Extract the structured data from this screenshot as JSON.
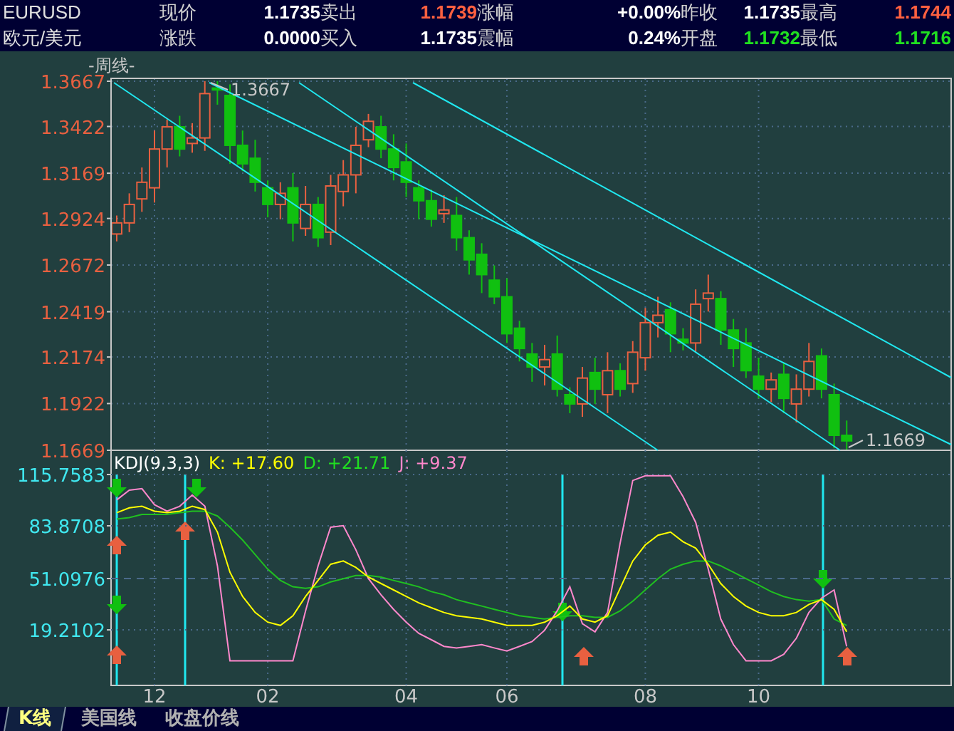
{
  "quote": {
    "symbol": "EURUSD",
    "name": "欧元/美元",
    "rows": [
      [
        {
          "label": "现价",
          "value": "1.1735",
          "color": "#ffffff"
        },
        {
          "label": "卖出",
          "value": "1.1739",
          "color": "#ff6040"
        },
        {
          "label": "涨幅",
          "value": "+0.00%",
          "color": "#ffffff"
        },
        {
          "label": "昨收",
          "value": "1.1735",
          "color": "#ffffff"
        },
        {
          "label": "最高",
          "value": "1.1744",
          "color": "#ff6040"
        }
      ],
      [
        {
          "label": "涨跌",
          "value": "0.0000",
          "color": "#ffffff"
        },
        {
          "label": "买入",
          "value": "1.1735",
          "color": "#ffffff"
        },
        {
          "label": "震幅",
          "value": "0.24%",
          "color": "#ffffff"
        },
        {
          "label": "开盘",
          "value": "1.1732",
          "color": "#20e020"
        },
        {
          "label": "最低",
          "value": "1.1716",
          "color": "#20e020"
        }
      ]
    ]
  },
  "chart": {
    "period_label": "-周线-",
    "high_label": "1.3667",
    "low_label": "1.1669",
    "chart_data": {
      "type": "candlestick",
      "categories": [
        null,
        null,
        null,
        null,
        null,
        null,
        null,
        null,
        null,
        null,
        null,
        null,
        null,
        null,
        null,
        null,
        null,
        null,
        null,
        null,
        null,
        null,
        null,
        null,
        null,
        null,
        null,
        null,
        null,
        null,
        null,
        null,
        null,
        null,
        null,
        null,
        null,
        null,
        null,
        null,
        null,
        null,
        null,
        null,
        null,
        null,
        null,
        null,
        null,
        null,
        null,
        null,
        null,
        null,
        null,
        null,
        null,
        null,
        null
      ],
      "grid": true,
      "ylim": [
        1.1669,
        1.3667
      ],
      "yticks": [
        {
          "value": 1.3667,
          "label": "1.3667"
        },
        {
          "value": 1.3422,
          "label": "1.3422"
        },
        {
          "value": 1.3169,
          "label": "1.3169"
        },
        {
          "value": 1.2924,
          "label": "1.2924"
        },
        {
          "value": 1.2672,
          "label": "1.2672"
        },
        {
          "value": 1.2419,
          "label": "1.2419"
        },
        {
          "value": 1.2174,
          "label": "1.2174"
        },
        {
          "value": 1.1922,
          "label": "1.1922"
        },
        {
          "value": 1.1669,
          "label": "1.1669"
        }
      ],
      "ohlc": [
        [
          1.284,
          1.294,
          1.28,
          1.29
        ],
        [
          1.29,
          1.306,
          1.285,
          1.3
        ],
        [
          1.303,
          1.32,
          1.296,
          1.312
        ],
        [
          1.309,
          1.34,
          1.301,
          1.33
        ],
        [
          1.33,
          1.346,
          1.32,
          1.342
        ],
        [
          1.342,
          1.348,
          1.326,
          1.33
        ],
        [
          1.333,
          1.344,
          1.328,
          1.336
        ],
        [
          1.336,
          1.3667,
          1.329,
          1.36
        ],
        [
          1.363,
          1.3667,
          1.354,
          1.362
        ],
        [
          1.359,
          1.365,
          1.322,
          1.332
        ],
        [
          1.332,
          1.34,
          1.318,
          1.322
        ],
        [
          1.325,
          1.335,
          1.307,
          1.312
        ],
        [
          1.309,
          1.313,
          1.293,
          1.3
        ],
        [
          1.3,
          1.312,
          1.292,
          1.306
        ],
        [
          1.309,
          1.317,
          1.28,
          1.29
        ],
        [
          1.287,
          1.31,
          1.283,
          1.3
        ],
        [
          1.3,
          1.304,
          1.277,
          1.282
        ],
        [
          1.285,
          1.316,
          1.278,
          1.31
        ],
        [
          1.307,
          1.324,
          1.299,
          1.316
        ],
        [
          1.316,
          1.342,
          1.306,
          1.332
        ],
        [
          1.335,
          1.349,
          1.331,
          1.345
        ],
        [
          1.342,
          1.348,
          1.325,
          1.33
        ],
        [
          1.33,
          1.338,
          1.313,
          1.32
        ],
        [
          1.323,
          1.333,
          1.304,
          1.312
        ],
        [
          1.309,
          1.313,
          1.292,
          1.302
        ],
        [
          1.302,
          1.308,
          1.288,
          1.292
        ],
        [
          1.295,
          1.305,
          1.29,
          1.297
        ],
        [
          1.294,
          1.304,
          1.275,
          1.282
        ],
        [
          1.282,
          1.286,
          1.262,
          1.27
        ],
        [
          1.273,
          1.279,
          1.252,
          1.262
        ],
        [
          1.259,
          1.267,
          1.246,
          1.25
        ],
        [
          1.25,
          1.26,
          1.225,
          1.23
        ],
        [
          1.233,
          1.237,
          1.215,
          1.222
        ],
        [
          1.219,
          1.225,
          1.204,
          1.212
        ],
        [
          1.212,
          1.224,
          1.202,
          1.216
        ],
        [
          1.219,
          1.229,
          1.196,
          1.2
        ],
        [
          1.197,
          1.201,
          1.187,
          1.192
        ],
        [
          1.192,
          1.212,
          1.185,
          1.206
        ],
        [
          1.209,
          1.217,
          1.192,
          1.2
        ],
        [
          1.197,
          1.22,
          1.187,
          1.21
        ],
        [
          1.21,
          1.214,
          1.196,
          1.2
        ],
        [
          1.203,
          1.226,
          1.198,
          1.22
        ],
        [
          1.217,
          1.244,
          1.21,
          1.236
        ],
        [
          1.236,
          1.25,
          1.228,
          1.24
        ],
        [
          1.243,
          1.247,
          1.22,
          1.23
        ],
        [
          1.227,
          1.233,
          1.221,
          1.225
        ],
        [
          1.225,
          1.254,
          1.22,
          1.246
        ],
        [
          1.249,
          1.262,
          1.242,
          1.252
        ],
        [
          1.249,
          1.253,
          1.224,
          1.232
        ],
        [
          1.232,
          1.238,
          1.212,
          1.222
        ],
        [
          1.225,
          1.233,
          1.206,
          1.21
        ],
        [
          1.207,
          1.217,
          1.195,
          1.2
        ],
        [
          1.2,
          1.209,
          1.193,
          1.205
        ],
        [
          1.208,
          1.214,
          1.187,
          1.195
        ],
        [
          1.192,
          1.208,
          1.182,
          1.2
        ],
        [
          1.2,
          1.225,
          1.196,
          1.215
        ],
        [
          1.218,
          1.222,
          1.195,
          1.2
        ],
        [
          1.197,
          1.203,
          1.168,
          1.175
        ],
        [
          1.175,
          1.183,
          1.1669,
          1.172
        ]
      ]
    },
    "indicator": {
      "legend": [
        {
          "text": "KDJ(9,3,3)",
          "color": "#ffffff"
        },
        {
          "text": "K: +17.60",
          "color": "#ffff00"
        },
        {
          "text": "D: +21.71",
          "color": "#20e020"
        },
        {
          "text": "J: +9.37",
          "color": "#ff88cc"
        }
      ],
      "chart_data": {
        "type": "line",
        "grid": true,
        "categories": [
          null,
          null,
          null,
          "12",
          null,
          null,
          null,
          null,
          null,
          null,
          null,
          null,
          "02",
          null,
          null,
          null,
          null,
          null,
          null,
          null,
          null,
          null,
          null,
          "04",
          null,
          null,
          null,
          null,
          null,
          null,
          null,
          "06",
          null,
          null,
          null,
          null,
          null,
          null,
          null,
          null,
          null,
          null,
          "08",
          null,
          null,
          null,
          null,
          null,
          null,
          null,
          null,
          "10",
          null,
          null,
          null,
          null,
          null,
          null,
          null
        ],
        "ylim": [
          -15.3,
          115.7583
        ],
        "yticks": [
          {
            "value": 115.7583,
            "label": "115.7583"
          },
          {
            "value": 83.8708,
            "label": "83.8708"
          },
          {
            "value": 51.0976,
            "label": "51.0976"
          },
          {
            "value": 19.2102,
            "label": "19.2102"
          }
        ],
        "series": [
          {
            "color": "#ff88cc",
            "values": [
              100,
              106,
              107,
              97,
              93,
              96,
              103,
              96,
              59,
              0,
              0,
              0,
              0,
              0,
              0,
              31,
              59,
              83,
              84,
              69,
              51,
              41,
              32,
              24,
              17,
              13,
              9,
              8,
              9,
              10,
              8,
              6,
              9,
              12,
              19,
              31,
              46,
              23,
              18,
              30,
              73,
              112,
              115,
              115,
              115,
              102,
              86,
              57,
              26,
              10,
              0,
              0,
              0,
              4,
              14,
              30,
              39,
              44,
              9
            ]
          },
          {
            "color": "#20c020",
            "values": [
              88,
              89,
              91,
              91,
              91,
              92,
              93,
              93,
              90,
              83,
              75,
              66,
              57,
              50,
              46,
              45,
              46,
              49,
              51,
              53,
              53,
              52,
              50,
              48,
              46,
              43,
              41,
              38,
              36,
              34,
              32,
              30,
              28,
              27,
              26,
              27,
              28,
              28,
              27,
              27,
              31,
              37,
              44,
              51,
              57,
              60,
              62,
              62,
              59,
              55,
              51,
              47,
              43,
              40,
              38,
              37,
              38,
              26,
              22
            ]
          },
          {
            "color": "#ffff00",
            "values": [
              92,
              95,
              96,
              93,
              92,
              93,
              96,
              94,
              80,
              55,
              40,
              30,
              24,
              22,
              28,
              40,
              50,
              60,
              62,
              58,
              52,
              48,
              44,
              40,
              36,
              33,
              30,
              28,
              27,
              26,
              24,
              22,
              22,
              22,
              24,
              28,
              34,
              26,
              24,
              28,
              45,
              62,
              72,
              78,
              80,
              74,
              70,
              60,
              48,
              40,
              34,
              30,
              28,
              28,
              30,
              35,
              38,
              32,
              18
            ]
          }
        ]
      }
    }
  },
  "tabs": [
    {
      "label": "K线",
      "selected": true
    },
    {
      "label": "美国线",
      "selected": false
    },
    {
      "label": "收盘价线",
      "selected": false
    }
  ]
}
